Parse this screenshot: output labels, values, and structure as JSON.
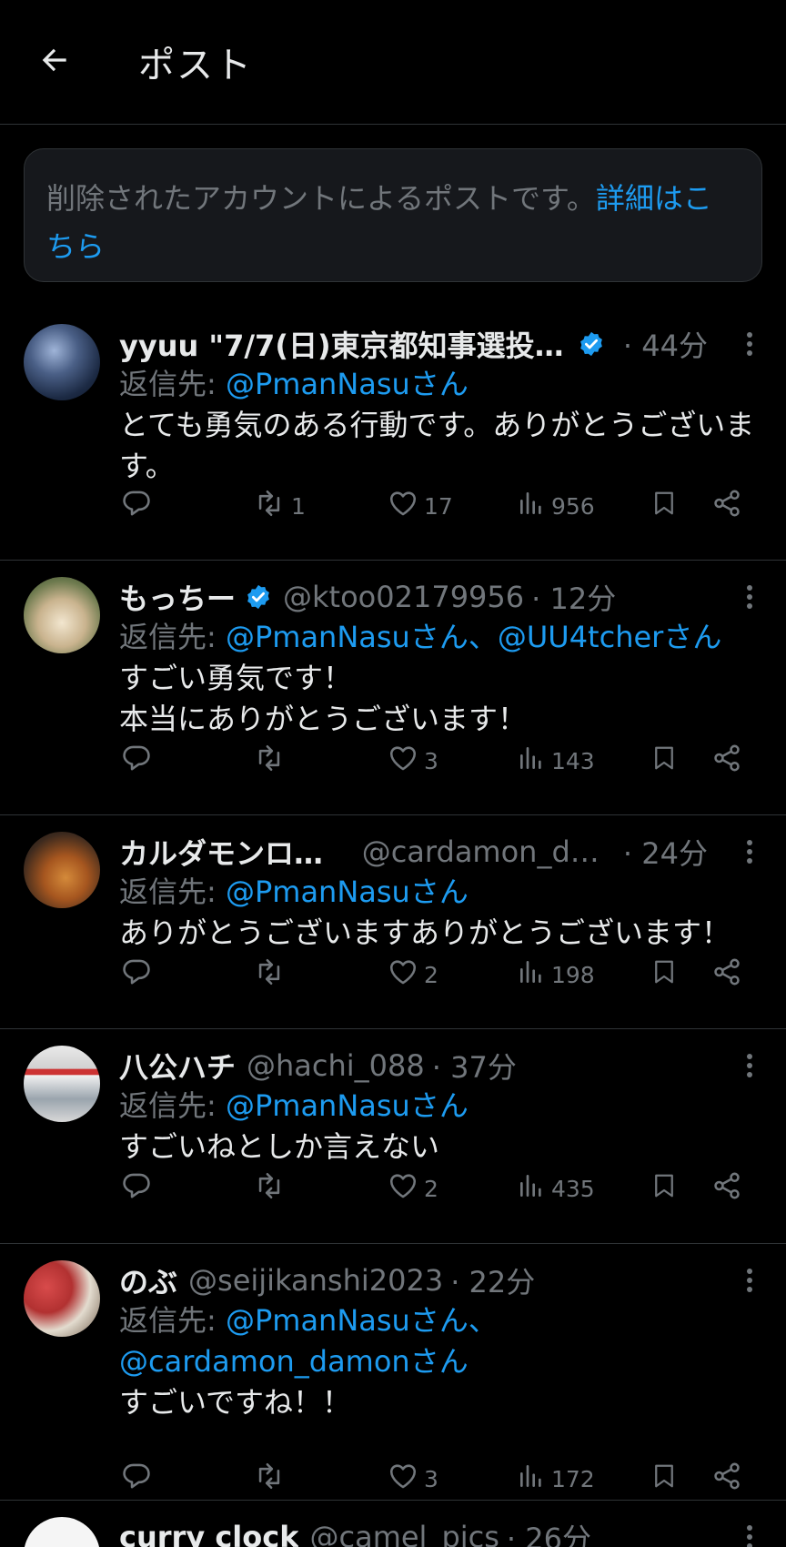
{
  "header": {
    "title": "ポスト"
  },
  "notice": {
    "text": "削除されたアカウントによるポストです。",
    "link": "詳細はこちら"
  },
  "replies": [
    {
      "name": "yyuu \"7/7(日)東京都知事選投票…",
      "verified": true,
      "handle": "",
      "time": "· 44分",
      "replyto_prefix": "返信先: ",
      "mentions": [
        "@PmanNasuさん"
      ],
      "text": "とても勇気のある行動です。ありがとうございます。",
      "stats": {
        "replies": "",
        "retweets": "1",
        "likes": "17",
        "views": "956"
      }
    },
    {
      "name": "もっちー",
      "verified": true,
      "handle": "@ktoo02179956",
      "time": "· 12分",
      "replyto_prefix": "返信先: ",
      "mentions": [
        "@PmanNasuさん、",
        "@UU4tcherさん"
      ],
      "text": "すごい勇気です！\n本当にありがとうございます！",
      "stats": {
        "replies": "",
        "retweets": "",
        "likes": "3",
        "views": "143"
      }
    },
    {
      "name": "カルダモンロール",
      "verified": false,
      "handle": "@cardamon_da…",
      "time": "· 24分",
      "replyto_prefix": "返信先: ",
      "mentions": [
        "@PmanNasuさん"
      ],
      "text": "ありがとうございますありがとうございます！",
      "stats": {
        "replies": "",
        "retweets": "",
        "likes": "2",
        "views": "198"
      }
    },
    {
      "name": "八公ハチ",
      "verified": false,
      "handle": "@hachi_088",
      "time": "· 37分",
      "replyto_prefix": "返信先: ",
      "mentions": [
        "@PmanNasuさん"
      ],
      "text": "すごいねとしか言えない",
      "stats": {
        "replies": "",
        "retweets": "",
        "likes": "2",
        "views": "435"
      }
    },
    {
      "name": "のぶ",
      "verified": false,
      "handle": "@seijikanshi2023",
      "time": "· 22分",
      "replyto_prefix": "返信先: ",
      "mentions": [
        "@PmanNasuさん、",
        "@cardamon_damonさん"
      ],
      "text": "すごいですね！！",
      "stats": {
        "replies": "",
        "retweets": "",
        "likes": "3",
        "views": "172"
      }
    },
    {
      "name": "curry clock",
      "verified": false,
      "handle": "@camel_pics",
      "time": "· 26分"
    }
  ]
}
